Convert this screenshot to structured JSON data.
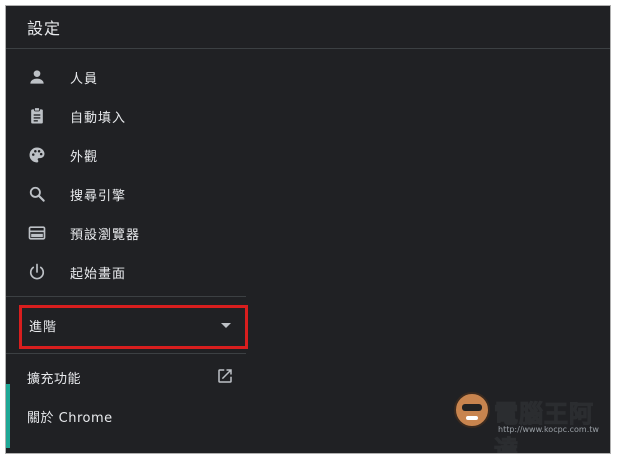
{
  "header": {
    "title": "設定"
  },
  "menu": {
    "items": [
      {
        "icon": "person-icon",
        "label": "人員"
      },
      {
        "icon": "clipboard-icon",
        "label": "自動填入"
      },
      {
        "icon": "palette-icon",
        "label": "外觀"
      },
      {
        "icon": "search-icon",
        "label": "搜尋引擎"
      },
      {
        "icon": "browser-window-icon",
        "label": "預設瀏覽器"
      },
      {
        "icon": "power-icon",
        "label": "起始畫面"
      }
    ],
    "advanced_label": "進階",
    "extensions_label": "擴充功能",
    "about_label": "關於 Chrome"
  },
  "watermark": {
    "title": "電腦王阿達",
    "url": "http://www.kocpc.com.tw"
  },
  "colors": {
    "background": "#202124",
    "text": "#e8eaed",
    "icon": "#bdc1c6",
    "highlight_border": "#d81e1e",
    "accent": "#1ea896"
  }
}
